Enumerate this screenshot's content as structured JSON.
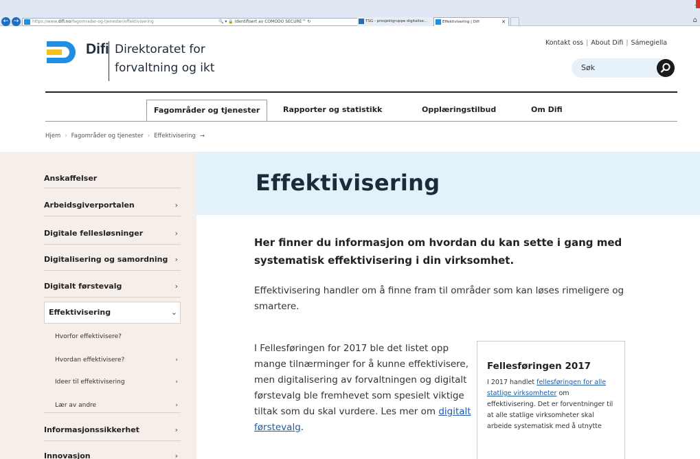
{
  "browser": {
    "url_prefix": "https://www.",
    "url_host": "difi.no",
    "url_path": "/fagomrader-og-tjenester/effektivisering",
    "security_text": "Identifisert av COMODO SECURE™",
    "tab1_title": "TSG - prosjektgruppe digitalise...",
    "tab2_title": "Effektivisering | Difi"
  },
  "header": {
    "logo_name": "Difi",
    "logo_line1": "Direktoratet for",
    "logo_line2": "forvaltning og ikt",
    "top_links": [
      "Kontakt oss",
      "About Difi",
      "Sámegiella"
    ],
    "search_placeholder": "Søk"
  },
  "nav": {
    "items": [
      "Fagområder og tjenester",
      "Rapporter og statistikk",
      "Opplæringstilbud",
      "Om Difi"
    ]
  },
  "breadcrumb": {
    "items": [
      "Hjem",
      "Fagområder og tjenester",
      "Effektivisering"
    ],
    "arrow": "→"
  },
  "sidebar": {
    "items": [
      {
        "label": "Anskaffelser",
        "chev": ""
      },
      {
        "label": "Arbeidsgiverportalen",
        "chev": "›"
      },
      {
        "label": "Digitale fellesløsninger",
        "chev": "›"
      },
      {
        "label": "Digitalisering og samordning",
        "chev": "›"
      },
      {
        "label": "Digitalt førstevalg",
        "chev": "›"
      },
      {
        "label": "Effektivisering",
        "chev": "⌄"
      },
      {
        "label": "Hvorfor effektivisere?",
        "chev": ""
      },
      {
        "label": "Hvordan effektivisere?",
        "chev": "›"
      },
      {
        "label": "Ideer til effektivisering",
        "chev": "›"
      },
      {
        "label": "Lær av andre",
        "chev": "›"
      },
      {
        "label": "Informasjonssikkerhet",
        "chev": "›"
      },
      {
        "label": "Innovasjon",
        "chev": "›"
      }
    ]
  },
  "main": {
    "title": "Effektivisering",
    "lead": "Her finner du informasjon om hvordan du kan sette i gang med systematisk effektivisering i din virksomhet.",
    "para1": "Effektivisering handler om å finne fram til områder som kan løses rimeligere og smartere.",
    "para2_before": "I Fellesføringen for 2017 ble det listet opp mange tilnærminger for å kunne effektivisere, men digitalisering av forvaltningen og digitalt førstevalg ble fremhevet som spesielt viktige tiltak som du skal vurdere. Les mer om ",
    "para2_link": "digitalt førstevalg",
    "para2_after": "."
  },
  "factbox": {
    "title": "Fellesføringen 2017",
    "text_before": "I 2017 handlet ",
    "link": "fellesføringen for alle statlige virksomheter",
    "text_after": " om effektivisering. Det er forventninger til at alle statlige virksomheter skal arbeide systematisk med å utnytte"
  },
  "colors": {
    "brand_blue": "#1f8fe3",
    "brand_yellow": "#f4c21b",
    "sidebar_bg": "#f6eee9",
    "hero_bg": "#e3f1fa",
    "link": "#1e5aa8"
  }
}
